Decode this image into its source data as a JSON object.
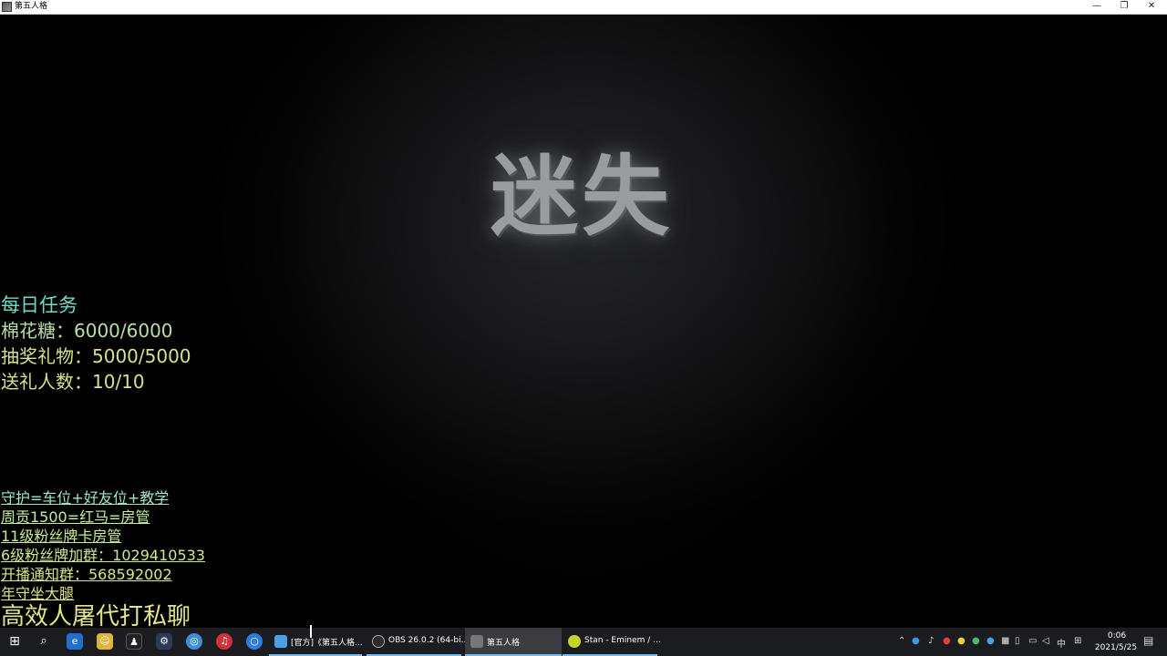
{
  "window": {
    "title": "第五人格",
    "minimize": "—",
    "restore": "❐",
    "close": "✕"
  },
  "game": {
    "title_text": "迷失"
  },
  "overlay": {
    "task_title": "每日任务",
    "tasks": [
      "棉花糖：6000/6000",
      "抽奖礼物：5000/5000",
      "送礼人数：10/10"
    ],
    "info": [
      "守护=车位+好友位+教学",
      "周贡1500=红马=房管",
      "11级粉丝牌卡房管",
      "6级粉丝牌加群：1029410533",
      "开播通知群：568592002",
      "年守坐大腿"
    ],
    "big_line": "高效人屠代打私聊"
  },
  "taskbar": {
    "apps": [
      {
        "label": "[官方]《第五人格..."
      },
      {
        "label": "OBS 26.0.2 (64-bi..."
      },
      {
        "label": "第五人格"
      },
      {
        "label": "Stan - Eminem / ..."
      }
    ],
    "tray_lang": "中",
    "clock_time": "0:06",
    "clock_date": "2021/5/25"
  },
  "colors": {
    "taskbar_bg": "#1b1c1f",
    "task_title": "#6fd9c8",
    "overlay_text": "#d7e08a"
  }
}
